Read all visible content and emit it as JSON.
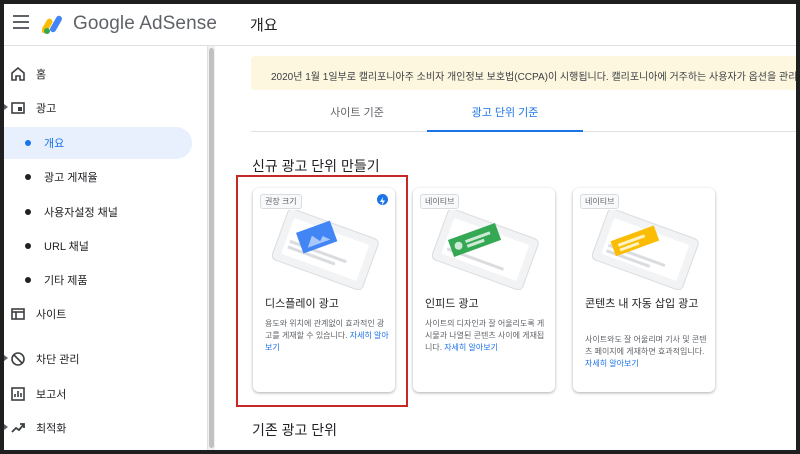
{
  "header": {
    "logo_text": "Google AdSense",
    "page_title": "개요"
  },
  "sidebar": {
    "items": [
      {
        "label": "홈",
        "icon": "home-icon"
      },
      {
        "label": "광고",
        "icon": "ads-icon"
      },
      {
        "label": "개요"
      },
      {
        "label": "광고 게재율"
      },
      {
        "label": "사용자설정 채널"
      },
      {
        "label": "URL 채널"
      },
      {
        "label": "기타 제품"
      },
      {
        "label": "사이트",
        "icon": "sites-icon"
      },
      {
        "label": "차단 관리",
        "icon": "block-icon"
      },
      {
        "label": "보고서",
        "icon": "report-icon"
      },
      {
        "label": "최적화",
        "icon": "trending-icon"
      }
    ]
  },
  "banner": {
    "text": "2020년 1월 1일부로 캘리포니아주 소비자 개인정보 보호법(CCPA)이 시행됩니다. 캘리포니아에 거주하는 사용자가 옵션을 관리하"
  },
  "tabs": [
    {
      "label": "사이트 기준"
    },
    {
      "label": "광고 단위 기준"
    }
  ],
  "sections": {
    "new_ad_unit": "신규 광고 단위 만들기",
    "existing_ad_unit": "기존 광고 단위"
  },
  "cards": [
    {
      "badge": "권장 크기",
      "title": "디스플레이 광고",
      "desc": "용도와 위치에 관계없이 효과적인 광고를 게재할 수 있습니다.",
      "link": "자세히 알아보기"
    },
    {
      "badge": "네이티브",
      "title": "인피드 광고",
      "desc": "사이트의 디자인과 잘 어울리도록 게시물과 나열된 콘텐츠 사이에 게재됩니다.",
      "link": "자세히 알아보기"
    },
    {
      "badge": "네이티브",
      "title": "콘텐츠 내 자동 삽입 광고",
      "desc": "사이트와도 잘 어울리며 기사 및 콘텐츠 페이지에 게재하면 효과적입니다.",
      "link": "자세히 알아보기"
    }
  ],
  "colors": {
    "accent": "#1a73e8",
    "highlight": "#c62828",
    "banner_bg": "#fef7e0",
    "logo_yellow": "#fbbc04",
    "logo_blue": "#4285f4",
    "logo_green": "#34a853",
    "illus_blue": "#4285f4",
    "illus_green": "#34a853",
    "illus_yellow": "#fbbc04"
  }
}
